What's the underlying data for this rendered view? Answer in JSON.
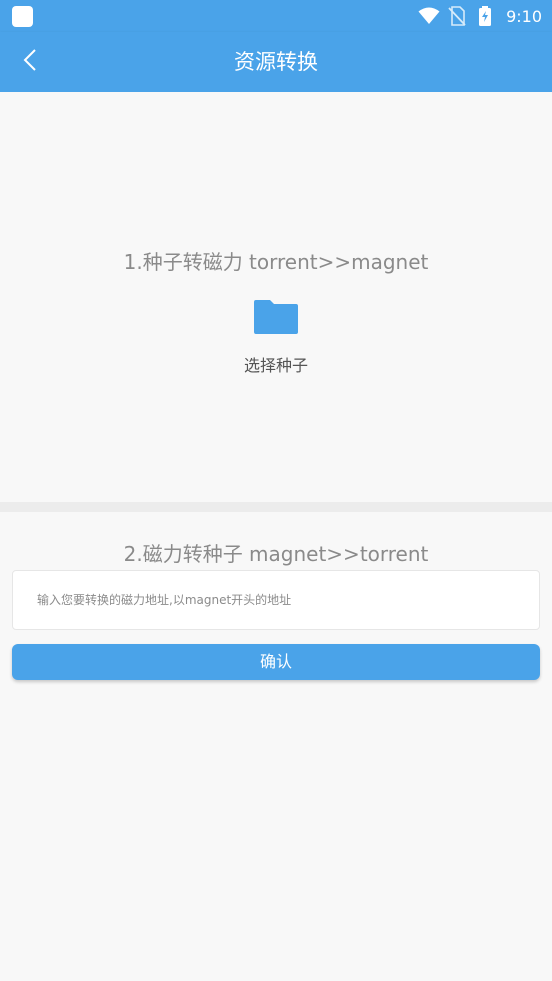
{
  "status_bar": {
    "time": "9:10",
    "icons": [
      "app-square-icon",
      "wifi-icon",
      "no-sim-icon",
      "battery-charging-icon"
    ]
  },
  "app_bar": {
    "title": "资源转换",
    "back_icon": "chevron-left-icon"
  },
  "section1": {
    "heading": "1.种子转磁力  torrent>>magnet",
    "folder_icon": "folder-icon",
    "choose_label": "选择种子"
  },
  "section2": {
    "heading": "2.磁力转种子  magnet>>torrent",
    "input_placeholder": "输入您要转换的磁力地址,以magnet开头的地址",
    "input_value": "",
    "confirm_label": "确认"
  },
  "colors": {
    "primary": "#4aa3e9",
    "background": "#f8f8f8",
    "divider": "#ececec",
    "heading_text": "#8a8a8a"
  }
}
